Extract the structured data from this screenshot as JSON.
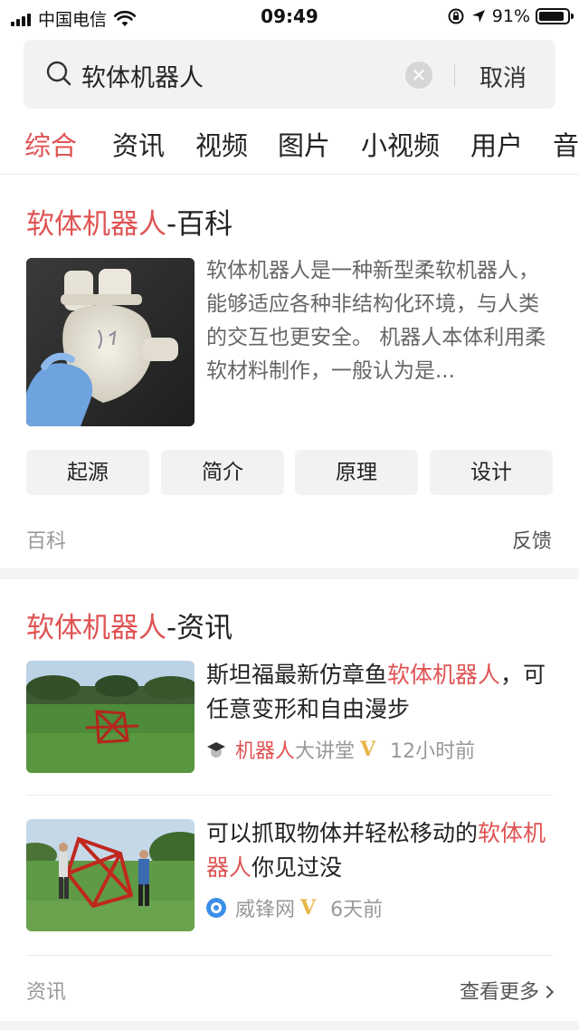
{
  "status_bar": {
    "carrier": "中国电信",
    "time": "09:49",
    "battery_percent": "91%",
    "battery_level": 0.91
  },
  "search": {
    "query": "软体机器人",
    "cancel_label": "取消"
  },
  "tabs": [
    {
      "label": "综合",
      "active": true
    },
    {
      "label": "资讯",
      "active": false
    },
    {
      "label": "视频",
      "active": false
    },
    {
      "label": "图片",
      "active": false
    },
    {
      "label": "小视频",
      "active": false
    },
    {
      "label": "用户",
      "active": false
    },
    {
      "label": "音",
      "active": false
    }
  ],
  "baike_card": {
    "title_keyword": "软体机器人",
    "title_suffix": "-百科",
    "description": "软体机器人是一种新型柔软机器人，能够适应各种非结构化环境，与人类的交互也更安全。 机器人本体利用柔软材料制作，一般认为是...",
    "chips": [
      "起源",
      "简介",
      "原理",
      "设计"
    ],
    "footer_label": "百科",
    "feedback_label": "反馈"
  },
  "news_card": {
    "title_keyword": "软体机器人",
    "title_suffix": "-资讯",
    "items": [
      {
        "title_before": "斯坦福最新仿章鱼",
        "title_keyword": "软体机器人",
        "title_after": "，可任意变形和自由漫步",
        "source_keyword": "机器人",
        "source_rest": "大讲堂",
        "verified": "V",
        "time": "12小时前"
      },
      {
        "title_before": "可以抓取物体并轻松移动的",
        "title_keyword": "软体机器人",
        "title_after": "你见过没",
        "source_keyword": "",
        "source_rest": "威锋网",
        "verified": "V",
        "time": "6天前"
      }
    ],
    "footer_label": "资讯",
    "more_label": "查看更多"
  },
  "colors": {
    "keyword": "#e05353",
    "active_tab": "#e05353",
    "verified_badge": "#e8b54a"
  }
}
